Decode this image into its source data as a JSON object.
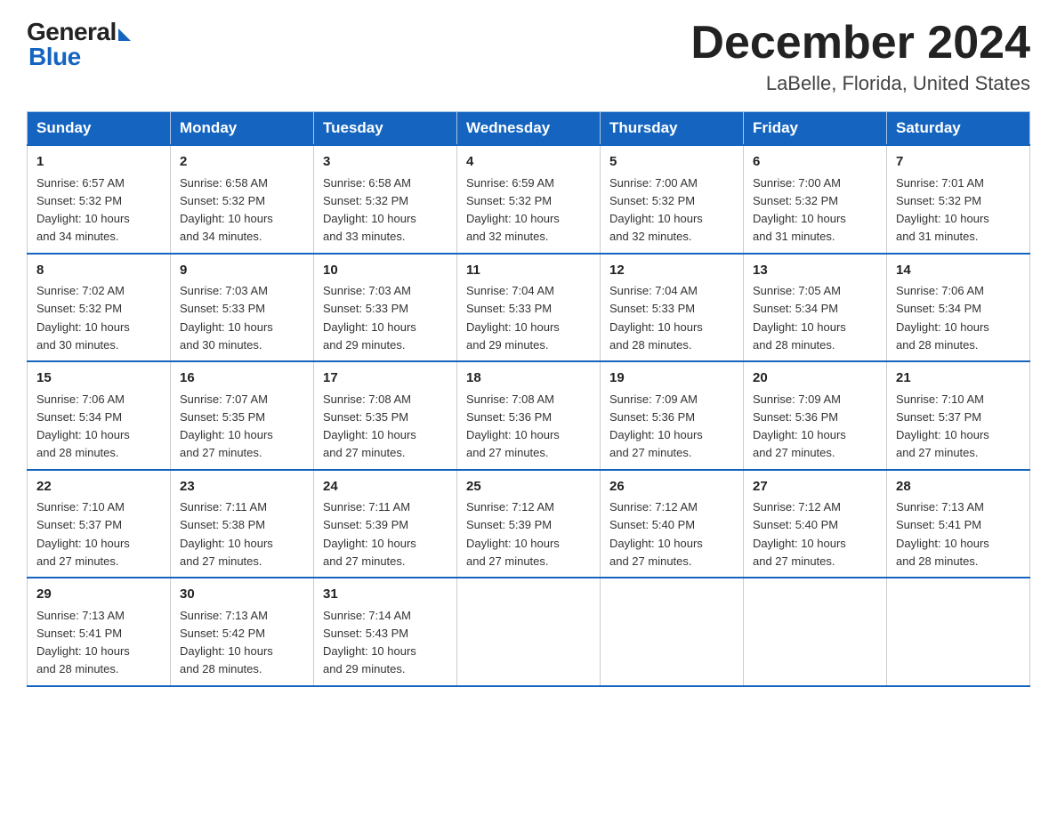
{
  "header": {
    "logo_general": "General",
    "logo_blue": "Blue",
    "month_title": "December 2024",
    "location": "LaBelle, Florida, United States"
  },
  "days_of_week": [
    "Sunday",
    "Monday",
    "Tuesday",
    "Wednesday",
    "Thursday",
    "Friday",
    "Saturday"
  ],
  "weeks": [
    [
      {
        "day": "1",
        "sunrise": "6:57 AM",
        "sunset": "5:32 PM",
        "daylight": "10 hours and 34 minutes."
      },
      {
        "day": "2",
        "sunrise": "6:58 AM",
        "sunset": "5:32 PM",
        "daylight": "10 hours and 34 minutes."
      },
      {
        "day": "3",
        "sunrise": "6:58 AM",
        "sunset": "5:32 PM",
        "daylight": "10 hours and 33 minutes."
      },
      {
        "day": "4",
        "sunrise": "6:59 AM",
        "sunset": "5:32 PM",
        "daylight": "10 hours and 32 minutes."
      },
      {
        "day": "5",
        "sunrise": "7:00 AM",
        "sunset": "5:32 PM",
        "daylight": "10 hours and 32 minutes."
      },
      {
        "day": "6",
        "sunrise": "7:00 AM",
        "sunset": "5:32 PM",
        "daylight": "10 hours and 31 minutes."
      },
      {
        "day": "7",
        "sunrise": "7:01 AM",
        "sunset": "5:32 PM",
        "daylight": "10 hours and 31 minutes."
      }
    ],
    [
      {
        "day": "8",
        "sunrise": "7:02 AM",
        "sunset": "5:32 PM",
        "daylight": "10 hours and 30 minutes."
      },
      {
        "day": "9",
        "sunrise": "7:03 AM",
        "sunset": "5:33 PM",
        "daylight": "10 hours and 30 minutes."
      },
      {
        "day": "10",
        "sunrise": "7:03 AM",
        "sunset": "5:33 PM",
        "daylight": "10 hours and 29 minutes."
      },
      {
        "day": "11",
        "sunrise": "7:04 AM",
        "sunset": "5:33 PM",
        "daylight": "10 hours and 29 minutes."
      },
      {
        "day": "12",
        "sunrise": "7:04 AM",
        "sunset": "5:33 PM",
        "daylight": "10 hours and 28 minutes."
      },
      {
        "day": "13",
        "sunrise": "7:05 AM",
        "sunset": "5:34 PM",
        "daylight": "10 hours and 28 minutes."
      },
      {
        "day": "14",
        "sunrise": "7:06 AM",
        "sunset": "5:34 PM",
        "daylight": "10 hours and 28 minutes."
      }
    ],
    [
      {
        "day": "15",
        "sunrise": "7:06 AM",
        "sunset": "5:34 PM",
        "daylight": "10 hours and 28 minutes."
      },
      {
        "day": "16",
        "sunrise": "7:07 AM",
        "sunset": "5:35 PM",
        "daylight": "10 hours and 27 minutes."
      },
      {
        "day": "17",
        "sunrise": "7:08 AM",
        "sunset": "5:35 PM",
        "daylight": "10 hours and 27 minutes."
      },
      {
        "day": "18",
        "sunrise": "7:08 AM",
        "sunset": "5:36 PM",
        "daylight": "10 hours and 27 minutes."
      },
      {
        "day": "19",
        "sunrise": "7:09 AM",
        "sunset": "5:36 PM",
        "daylight": "10 hours and 27 minutes."
      },
      {
        "day": "20",
        "sunrise": "7:09 AM",
        "sunset": "5:36 PM",
        "daylight": "10 hours and 27 minutes."
      },
      {
        "day": "21",
        "sunrise": "7:10 AM",
        "sunset": "5:37 PM",
        "daylight": "10 hours and 27 minutes."
      }
    ],
    [
      {
        "day": "22",
        "sunrise": "7:10 AM",
        "sunset": "5:37 PM",
        "daylight": "10 hours and 27 minutes."
      },
      {
        "day": "23",
        "sunrise": "7:11 AM",
        "sunset": "5:38 PM",
        "daylight": "10 hours and 27 minutes."
      },
      {
        "day": "24",
        "sunrise": "7:11 AM",
        "sunset": "5:39 PM",
        "daylight": "10 hours and 27 minutes."
      },
      {
        "day": "25",
        "sunrise": "7:12 AM",
        "sunset": "5:39 PM",
        "daylight": "10 hours and 27 minutes."
      },
      {
        "day": "26",
        "sunrise": "7:12 AM",
        "sunset": "5:40 PM",
        "daylight": "10 hours and 27 minutes."
      },
      {
        "day": "27",
        "sunrise": "7:12 AM",
        "sunset": "5:40 PM",
        "daylight": "10 hours and 27 minutes."
      },
      {
        "day": "28",
        "sunrise": "7:13 AM",
        "sunset": "5:41 PM",
        "daylight": "10 hours and 28 minutes."
      }
    ],
    [
      {
        "day": "29",
        "sunrise": "7:13 AM",
        "sunset": "5:41 PM",
        "daylight": "10 hours and 28 minutes."
      },
      {
        "day": "30",
        "sunrise": "7:13 AM",
        "sunset": "5:42 PM",
        "daylight": "10 hours and 28 minutes."
      },
      {
        "day": "31",
        "sunrise": "7:14 AM",
        "sunset": "5:43 PM",
        "daylight": "10 hours and 29 minutes."
      },
      null,
      null,
      null,
      null
    ]
  ],
  "labels": {
    "sunrise": "Sunrise:",
    "sunset": "Sunset:",
    "daylight": "Daylight:"
  }
}
